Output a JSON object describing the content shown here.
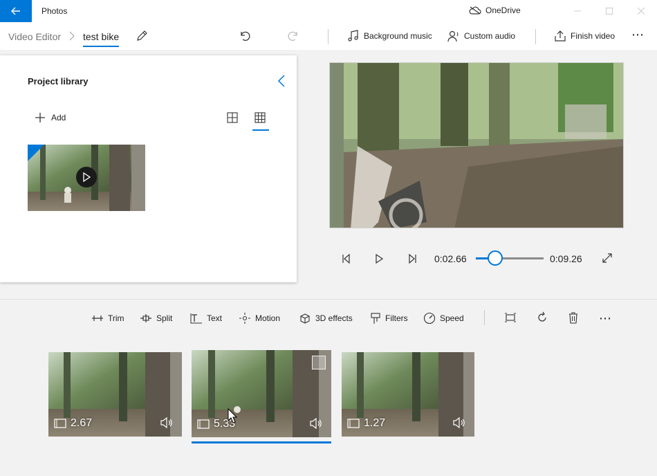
{
  "titlebar": {
    "app_title": "Photos",
    "onedrive_label": "OneDrive"
  },
  "commandbar": {
    "breadcrumb_root": "Video Editor",
    "breadcrumb_current": "test bike",
    "background_music": "Background music",
    "custom_audio": "Custom audio",
    "finish_video": "Finish video"
  },
  "library": {
    "title": "Project library",
    "add_label": "Add"
  },
  "player": {
    "current_time": "0:02.66",
    "total_time": "0:09.26",
    "progress": 0.287
  },
  "storyboard": {
    "tools": {
      "trim": "Trim",
      "split": "Split",
      "text": "Text",
      "motion": "Motion",
      "effects_3d": "3D effects",
      "filters": "Filters",
      "speed": "Speed"
    },
    "clips": [
      {
        "duration": "2.67"
      },
      {
        "duration": "5.33"
      },
      {
        "duration": "1.27"
      }
    ]
  },
  "colors": {
    "accent": "#0078d7"
  }
}
